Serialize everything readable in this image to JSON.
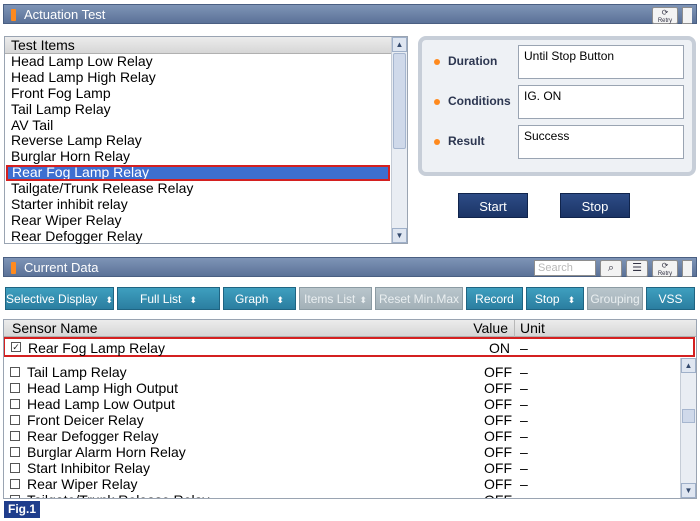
{
  "actuation_test": {
    "title": "Actuation Test",
    "retry_label": "Retry",
    "list_header": "Test Items",
    "items": [
      "Head Lamp Low Relay",
      "Head Lamp High Relay",
      "Front Fog Lamp",
      "Tail Lamp Relay",
      "AV Tail",
      "Reverse Lamp Relay",
      "Burglar Horn Relay",
      "Rear Fog Lamp Relay",
      "Tailgate/Trunk Release Relay",
      "Starter inhibit relay",
      "Rear Wiper Relay",
      "Rear Defogger Relay"
    ],
    "selected_item": "Rear Fog Lamp Relay",
    "duration_label": "Duration",
    "duration_value": "Until Stop Button",
    "conditions_label": "Conditions",
    "conditions_value": "IG. ON",
    "result_label": "Result",
    "result_value": "Success",
    "start_label": "Start",
    "stop_label": "Stop"
  },
  "current_data": {
    "title": "Current Data",
    "search_placeholder": "Search",
    "retry_label": "Retry",
    "toolbar": {
      "selective_display": "Selective Display",
      "full_list": "Full List",
      "graph": "Graph",
      "items_list": "Items List",
      "reset_min_max": "Reset Min.Max",
      "record": "Record",
      "stop": "Stop",
      "grouping": "Grouping",
      "vss": "VSS"
    },
    "columns": {
      "sensor_name": "Sensor Name",
      "value": "Value",
      "unit": "Unit"
    },
    "pinned_row": {
      "name": "Rear Fog Lamp Relay",
      "value": "ON",
      "unit": "–",
      "checked": true
    },
    "rows": [
      {
        "name": "Tail Lamp Relay",
        "value": "OFF",
        "unit": "–"
      },
      {
        "name": "Head Lamp High Output",
        "value": "OFF",
        "unit": "–"
      },
      {
        "name": "Head Lamp Low Output",
        "value": "OFF",
        "unit": "–"
      },
      {
        "name": "Front Deicer Relay",
        "value": "OFF",
        "unit": "–"
      },
      {
        "name": "Rear Defogger Relay",
        "value": "OFF",
        "unit": "–"
      },
      {
        "name": "Burglar Alarm Horn Relay",
        "value": "OFF",
        "unit": "–"
      },
      {
        "name": "Start Inhibitor Relay",
        "value": "OFF",
        "unit": "–"
      },
      {
        "name": "Rear Wiper Relay",
        "value": "OFF",
        "unit": "–"
      },
      {
        "name": "Tailgate/Trunk Release Relay",
        "value": "OFF",
        "unit": "–"
      }
    ]
  },
  "figure_label": "Fig.1",
  "colors": {
    "title_bar": "#5b7298",
    "accent_orange": "#ff8a1e",
    "selected_row": "#3d6fd0",
    "highlight_red": "#d42020",
    "action_button": "#1b3466",
    "toolbar_button": "#2b7ea0"
  }
}
